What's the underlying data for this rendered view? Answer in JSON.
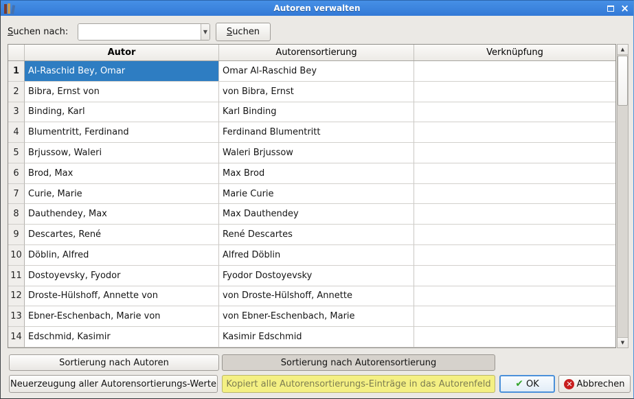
{
  "window": {
    "title": "Autoren verwalten"
  },
  "search": {
    "label_accel": "S",
    "label_rest": "uchen nach:",
    "input_value": "",
    "button_accel": "S",
    "button_rest": "uchen"
  },
  "table": {
    "columns": [
      "Autor",
      "Autorensortierung",
      "Verknüpfung"
    ],
    "rows": [
      {
        "num": "1",
        "autor": "Al-Raschid Bey, Omar",
        "sort": "Omar Al-Raschid Bey",
        "link": "",
        "selected": true
      },
      {
        "num": "2",
        "autor": "Bibra, Ernst von",
        "sort": "von Bibra, Ernst",
        "link": ""
      },
      {
        "num": "3",
        "autor": "Binding, Karl",
        "sort": "Karl Binding",
        "link": ""
      },
      {
        "num": "4",
        "autor": "Blumentritt, Ferdinand",
        "sort": "Ferdinand Blumentritt",
        "link": ""
      },
      {
        "num": "5",
        "autor": "Brjussow, Waleri",
        "sort": "Waleri Brjussow",
        "link": ""
      },
      {
        "num": "6",
        "autor": "Brod, Max",
        "sort": "Max Brod",
        "link": ""
      },
      {
        "num": "7",
        "autor": "Curie, Marie",
        "sort": "Marie Curie",
        "link": ""
      },
      {
        "num": "8",
        "autor": "Dauthendey, Max",
        "sort": "Max Dauthendey",
        "link": ""
      },
      {
        "num": "9",
        "autor": "Descartes, René",
        "sort": "René Descartes",
        "link": ""
      },
      {
        "num": "10",
        "autor": "Döblin, Alfred",
        "sort": "Alfred Döblin",
        "link": ""
      },
      {
        "num": "11",
        "autor": "Dostoyevsky, Fyodor",
        "sort": "Fyodor Dostoyevsky",
        "link": ""
      },
      {
        "num": "12",
        "autor": "Droste-Hülshoff, Annette von",
        "sort": "von Droste-Hülshoff, Annette",
        "link": ""
      },
      {
        "num": "13",
        "autor": "Ebner-Eschenbach, Marie von",
        "sort": "von Ebner-Eschenbach, Marie",
        "link": ""
      },
      {
        "num": "14",
        "autor": "Edschmid, Kasimir",
        "sort": "Kasimir Edschmid",
        "link": ""
      }
    ]
  },
  "actions": {
    "sort_by_authors": "Sortierung nach Autoren",
    "sort_by_author_sort": "Sortierung nach Autorensortierung",
    "recalc_all": "Neuerzeugung aller Autorensortierungs-Werte",
    "copy_to_author": "Kopiert alle Autorensortierungs-Einträge in das Autorenfeld",
    "ok": "OK",
    "cancel": "Abbrechen"
  },
  "colors": {
    "titlebar": "#3a82dc",
    "selection": "#2e7dc2",
    "highlight_button": "#f4f083",
    "ok_border": "#4a90d9",
    "ok_check": "#34a42c",
    "cancel_icon": "#c81e1e"
  }
}
